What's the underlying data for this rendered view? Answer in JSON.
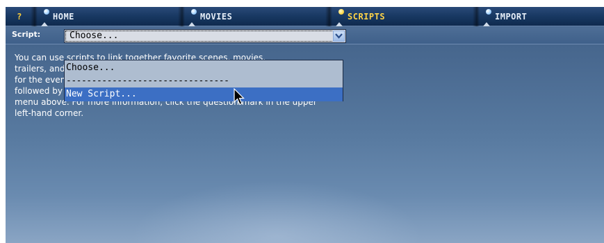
{
  "tabs": {
    "help": "?",
    "home": "HOME",
    "movies": "MOVIES",
    "scripts": "SCRIPTS",
    "import": "IMPORT"
  },
  "script_bar": {
    "label": "Script:",
    "selected_value": "Choose..."
  },
  "dropdown": {
    "options": [
      "Choose...",
      "--------------------------------",
      "New Script..."
    ],
    "highlighted_index": 2
  },
  "description": "You can use scripts to link together favorite scenes, movies,\ntrailers, and other items. You can also put together a program\nfor the evening. For example, you can play a few trailers and favorite scenes\nfollowed by the feature film. To get started, choose \"New Script...\" from the\nmenu above. For more information, click the question mark in the upper\nleft-hand corner.",
  "colors": {
    "active_tab": "#ffd447",
    "highlight": "#3c6fc4",
    "panel": "#4a6a91"
  },
  "icons": {
    "tab_marker": "blue-dot-icon",
    "active_tab_marker": "yellow-dot-icon",
    "select_arrow": "chevron-down-icon",
    "cursor": "mouse-pointer-icon"
  }
}
